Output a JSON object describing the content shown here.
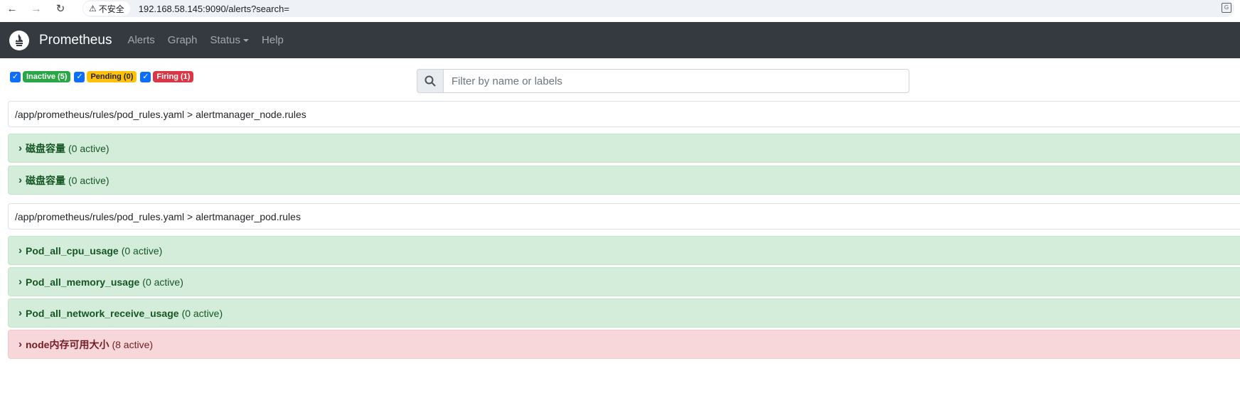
{
  "browser": {
    "back_icon": "arrow-left-icon",
    "forward_icon": "arrow-right-icon",
    "reload_icon": "reload-icon",
    "security_label": "不安全",
    "url": "192.168.58.145:9090/alerts?search="
  },
  "navbar": {
    "brand": "Prometheus",
    "links": {
      "alerts": "Alerts",
      "graph": "Graph",
      "status": "Status",
      "help": "Help"
    }
  },
  "filters": {
    "inactive": "Inactive (5)",
    "pending": "Pending (0)",
    "firing": "Firing (1)"
  },
  "search": {
    "placeholder": "Filter by name or labels",
    "value": ""
  },
  "groups": [
    {
      "header": "/app/prometheus/rules/pod_rules.yaml > alertmanager_node.rules",
      "rules": [
        {
          "name": "磁盘容量",
          "count": "(0 active)",
          "state": "inactive"
        },
        {
          "name": "磁盘容量",
          "count": "(0 active)",
          "state": "inactive"
        }
      ]
    },
    {
      "header": "/app/prometheus/rules/pod_rules.yaml > alertmanager_pod.rules",
      "rules": [
        {
          "name": "Pod_all_cpu_usage",
          "count": "(0 active)",
          "state": "inactive"
        },
        {
          "name": "Pod_all_memory_usage",
          "count": "(0 active)",
          "state": "inactive"
        },
        {
          "name": "Pod_all_network_receive_usage",
          "count": "(0 active)",
          "state": "inactive"
        },
        {
          "name": "node内存可用大小",
          "count": "(8 active)",
          "state": "firing"
        }
      ]
    }
  ],
  "colors": {
    "navbar_bg": "#343a40",
    "inactive_row_bg": "#d4edda",
    "firing_row_bg": "#f8d7da",
    "checkbox_blue": "#0d6efd"
  }
}
